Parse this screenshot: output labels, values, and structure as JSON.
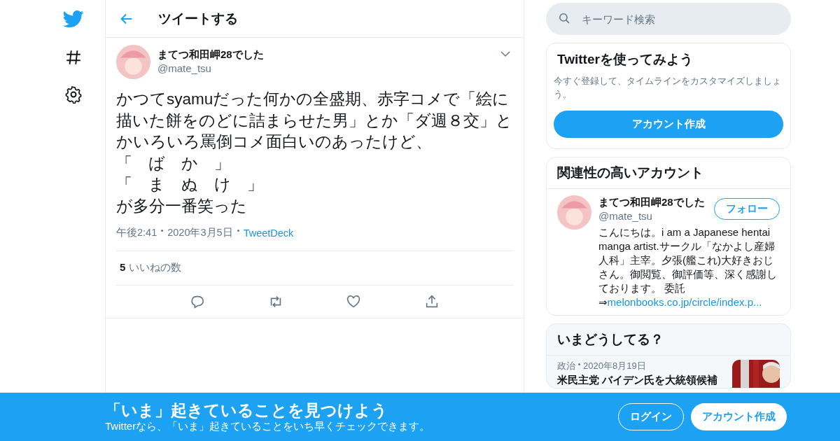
{
  "header": {
    "title": "ツイートする"
  },
  "search": {
    "placeholder": "キーワード検索"
  },
  "tweet": {
    "name": "まてつ和田岬28でした",
    "handle": "@mate_tsu",
    "lines": [
      "かつてsyamuだった何かの全盛期、赤字コメで「絵に",
      "描いた餅をのどに詰まらせた男」とか「ダ週８交」と",
      "かいろいろ罵倒コメ面白いのあったけど、",
      "「　ば　か　」",
      "「　ま　ぬ　け　」",
      "が多分一番笑った"
    ],
    "time": "午後2:41",
    "date": "2020年3月5日",
    "source": "TweetDeck",
    "likes_count": "5",
    "likes_label": "いいねの数"
  },
  "signup": {
    "title": "Twitterを使ってみよう",
    "text": "今すぐ登録して、タイムラインをカスタマイズしましょう。",
    "button": "アカウント作成"
  },
  "related": {
    "title": "関連性の高いアカウント",
    "name": "まてつ和田岬28でした",
    "handle": "@mate_tsu",
    "follow": "フォロー",
    "bio": "こんにちは。i am a Japanese hentai manga artist.サークル「なかよし産婦人科」主宰。夕張(艦これ)大好きおじさん。御閲覧、御評価等、深く感謝しております。 委託",
    "link_prefix": "⇒",
    "link": "melonbooks.co.jp/circle/index.p..."
  },
  "trends": {
    "title": "いまどうしてる？",
    "category": "政治",
    "date": "2020年8月19日",
    "headline": "米民主党 バイデン氏を大統領候補"
  },
  "banner": {
    "title": "「いま」起きていることを見つけよう",
    "subtitle": "Twitterなら、「いま」起きていることをいち早くチェックできます。",
    "login": "ログイン",
    "signup": "アカウント作成"
  }
}
